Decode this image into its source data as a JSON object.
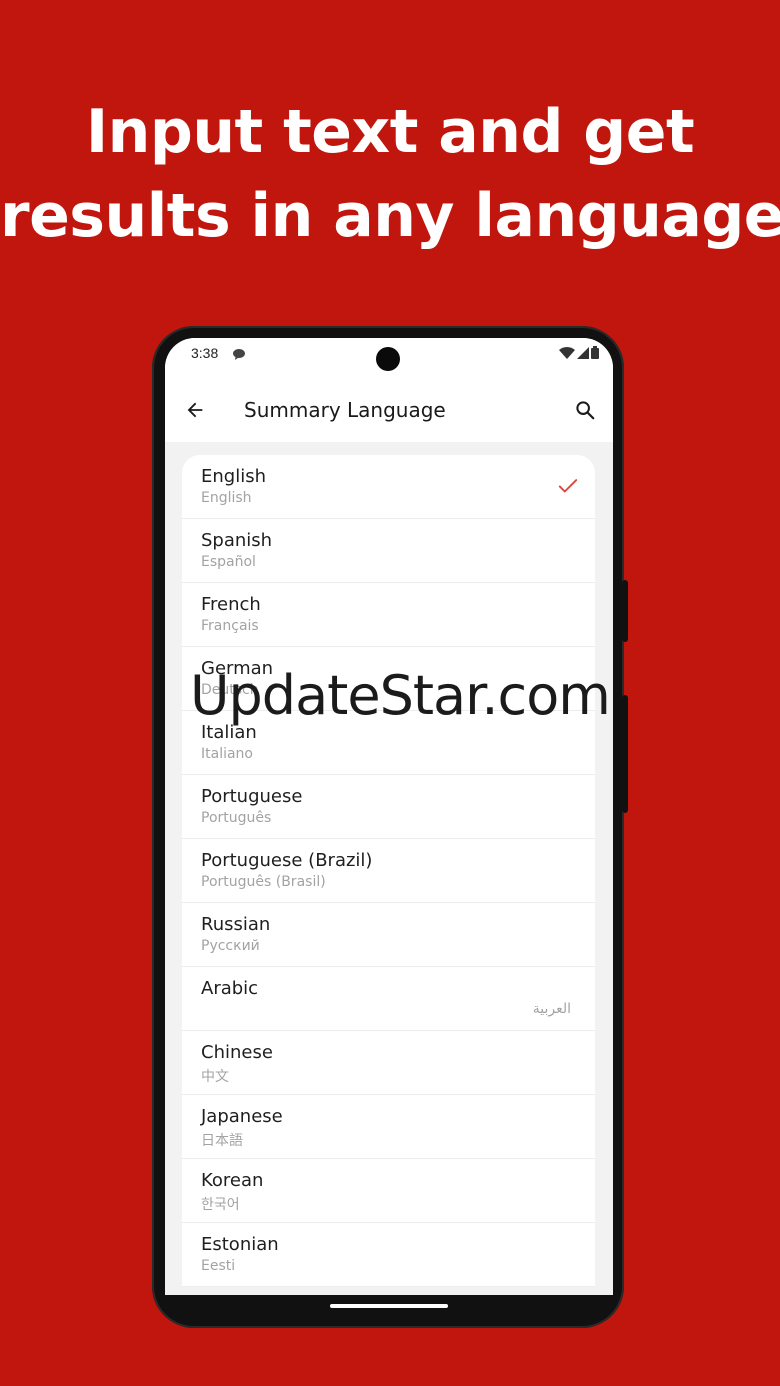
{
  "headline": {
    "line1": "Input text and get",
    "line2": "results in any language"
  },
  "status_bar": {
    "time": "3:38",
    "icons": [
      "message-icon",
      "wifi-icon",
      "signal-icon",
      "battery-icon"
    ]
  },
  "app_bar": {
    "title": "Summary Language",
    "back_icon": "arrow-left-icon",
    "search_icon": "search-icon"
  },
  "languages": [
    {
      "name": "English",
      "native": "English",
      "selected": true
    },
    {
      "name": "Spanish",
      "native": "Español"
    },
    {
      "name": "French",
      "native": "Français"
    },
    {
      "name": "German",
      "native": "Deutsch"
    },
    {
      "name": "Italian",
      "native": "Italiano"
    },
    {
      "name": "Portuguese",
      "native": "Português"
    },
    {
      "name": "Portuguese (Brazil)",
      "native": "Português (Brasil)"
    },
    {
      "name": "Russian",
      "native": "Русский"
    },
    {
      "name": "Arabic",
      "native": "العربية"
    },
    {
      "name": "Chinese",
      "native": "中文"
    },
    {
      "name": "Japanese",
      "native": "日本語"
    },
    {
      "name": "Korean",
      "native": "한국어"
    },
    {
      "name": "Estonian",
      "native": "Eesti"
    }
  ],
  "watermark": "UpdateStar.com",
  "colors": {
    "background": "#c0160e",
    "accent_check": "#d9443c"
  }
}
